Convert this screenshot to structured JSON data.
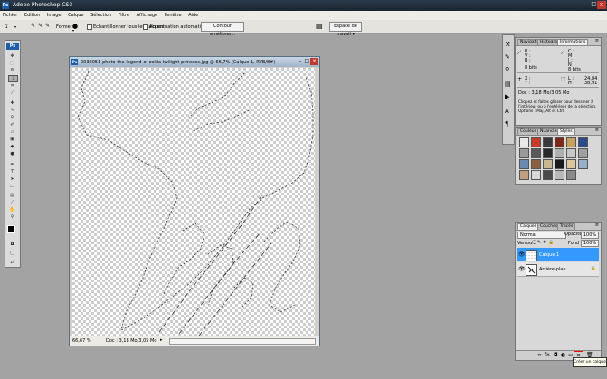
{
  "app": {
    "title": "Adobe Photoshop CS3",
    "logo": "Ps"
  },
  "menu": [
    "Fichier",
    "Edition",
    "Image",
    "Calque",
    "Sélection",
    "Filtre",
    "Affichage",
    "Fenêtre",
    "Aide"
  ],
  "options": {
    "forme_label": "Forme :",
    "echantillonner": "Echantillonner tous les calques",
    "accentuation": "Accentuation automatique",
    "contour_button": "Contour améliorer...",
    "workspace": "Espace de travail ▾"
  },
  "document": {
    "title": "0039051-photo-the-legend-of-zelda-twilight-princess.jpg @ 66,7% (Calque 1, RVB/8#)",
    "zoom": "66,67 %",
    "doc_info": "Doc : 3,18 Mo/3,05 Mo"
  },
  "info_panel": {
    "tabs": [
      "Navigati",
      "Histogra",
      "Informations"
    ],
    "r": "R :",
    "v": "V :",
    "b": "B :",
    "c": "C :",
    "m": "M :",
    "j": "J :",
    "n": "N :",
    "bits": "8 bits",
    "x": "X :",
    "y": "Y :",
    "l": "L :",
    "h": "H :",
    "w_val": "24,84",
    "h_val": "38,91",
    "doc": "Doc : 3,18 Mo/3,05 Mo",
    "help": "Cliquez et faites glisser pour dessiner à l'intérieur ou à l'extérieur de la sélection. Options : Maj, Alt et Ctrl."
  },
  "styles_panel": {
    "tabs": [
      "Couleur",
      "Nuancier",
      "Styles"
    ],
    "swatches": [
      "#e8e8e8",
      "#c83a2a",
      "#3a3a3a",
      "#7a2a1a",
      "#c8a060",
      "#2a4a8a",
      "#9a9a9a",
      "#5a5a5a",
      "#2a2a2a",
      "#b0b0b0",
      "#c8c8c8",
      "#a0a0a0",
      "#6a8ab0",
      "#8a6040",
      "#c8b890",
      "#1a1a1a",
      "#d8c8a0",
      "#9ab0c8",
      "#c0a080",
      "#d8d8d8",
      "#4a4a4a",
      "#b8b8b8",
      "#8a8a8a"
    ]
  },
  "layers_panel": {
    "tabs": [
      "Calques",
      "Couches",
      "Tracés"
    ],
    "blend": "Normal",
    "opacity_label": "Opacité :",
    "opacity": "100%",
    "lock_label": "Verrou :",
    "fill_label": "Fond :",
    "fill": "100%",
    "layers": [
      {
        "name": "Calque 1",
        "selected": true
      },
      {
        "name": "Arrière-plan",
        "selected": false
      }
    ],
    "tooltip": "Créer un calque"
  },
  "colors": {
    "accent": "#3399ff",
    "highlight": "#ff0000"
  }
}
